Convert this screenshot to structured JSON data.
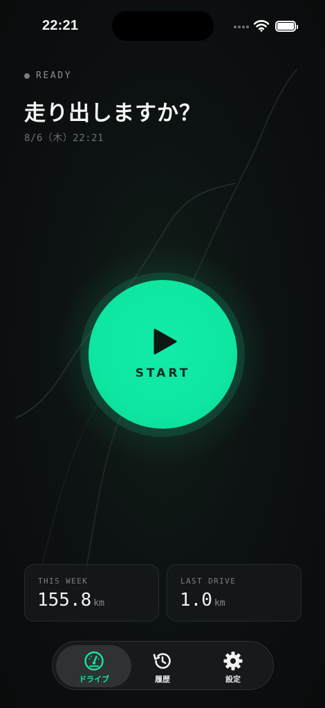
{
  "status_bar": {
    "time": "22:21"
  },
  "header": {
    "status": "READY",
    "title": "走り出しますか？",
    "date": "8/6（木）22:21"
  },
  "start_button": {
    "label": "START"
  },
  "stats": [
    {
      "label": "THIS WEEK",
      "value": "155.8",
      "unit": "km"
    },
    {
      "label": "LAST DRIVE",
      "value": "1.0",
      "unit": "km"
    }
  ],
  "tab_bar": {
    "items": [
      {
        "label": "ドライブ",
        "icon": "speedometer-icon",
        "active": true
      },
      {
        "label": "履歴",
        "icon": "history-icon",
        "active": false
      },
      {
        "label": "設定",
        "icon": "gear-icon",
        "active": false
      }
    ]
  },
  "colors": {
    "accent": "#12eca8",
    "background": "#0b0d0e"
  }
}
